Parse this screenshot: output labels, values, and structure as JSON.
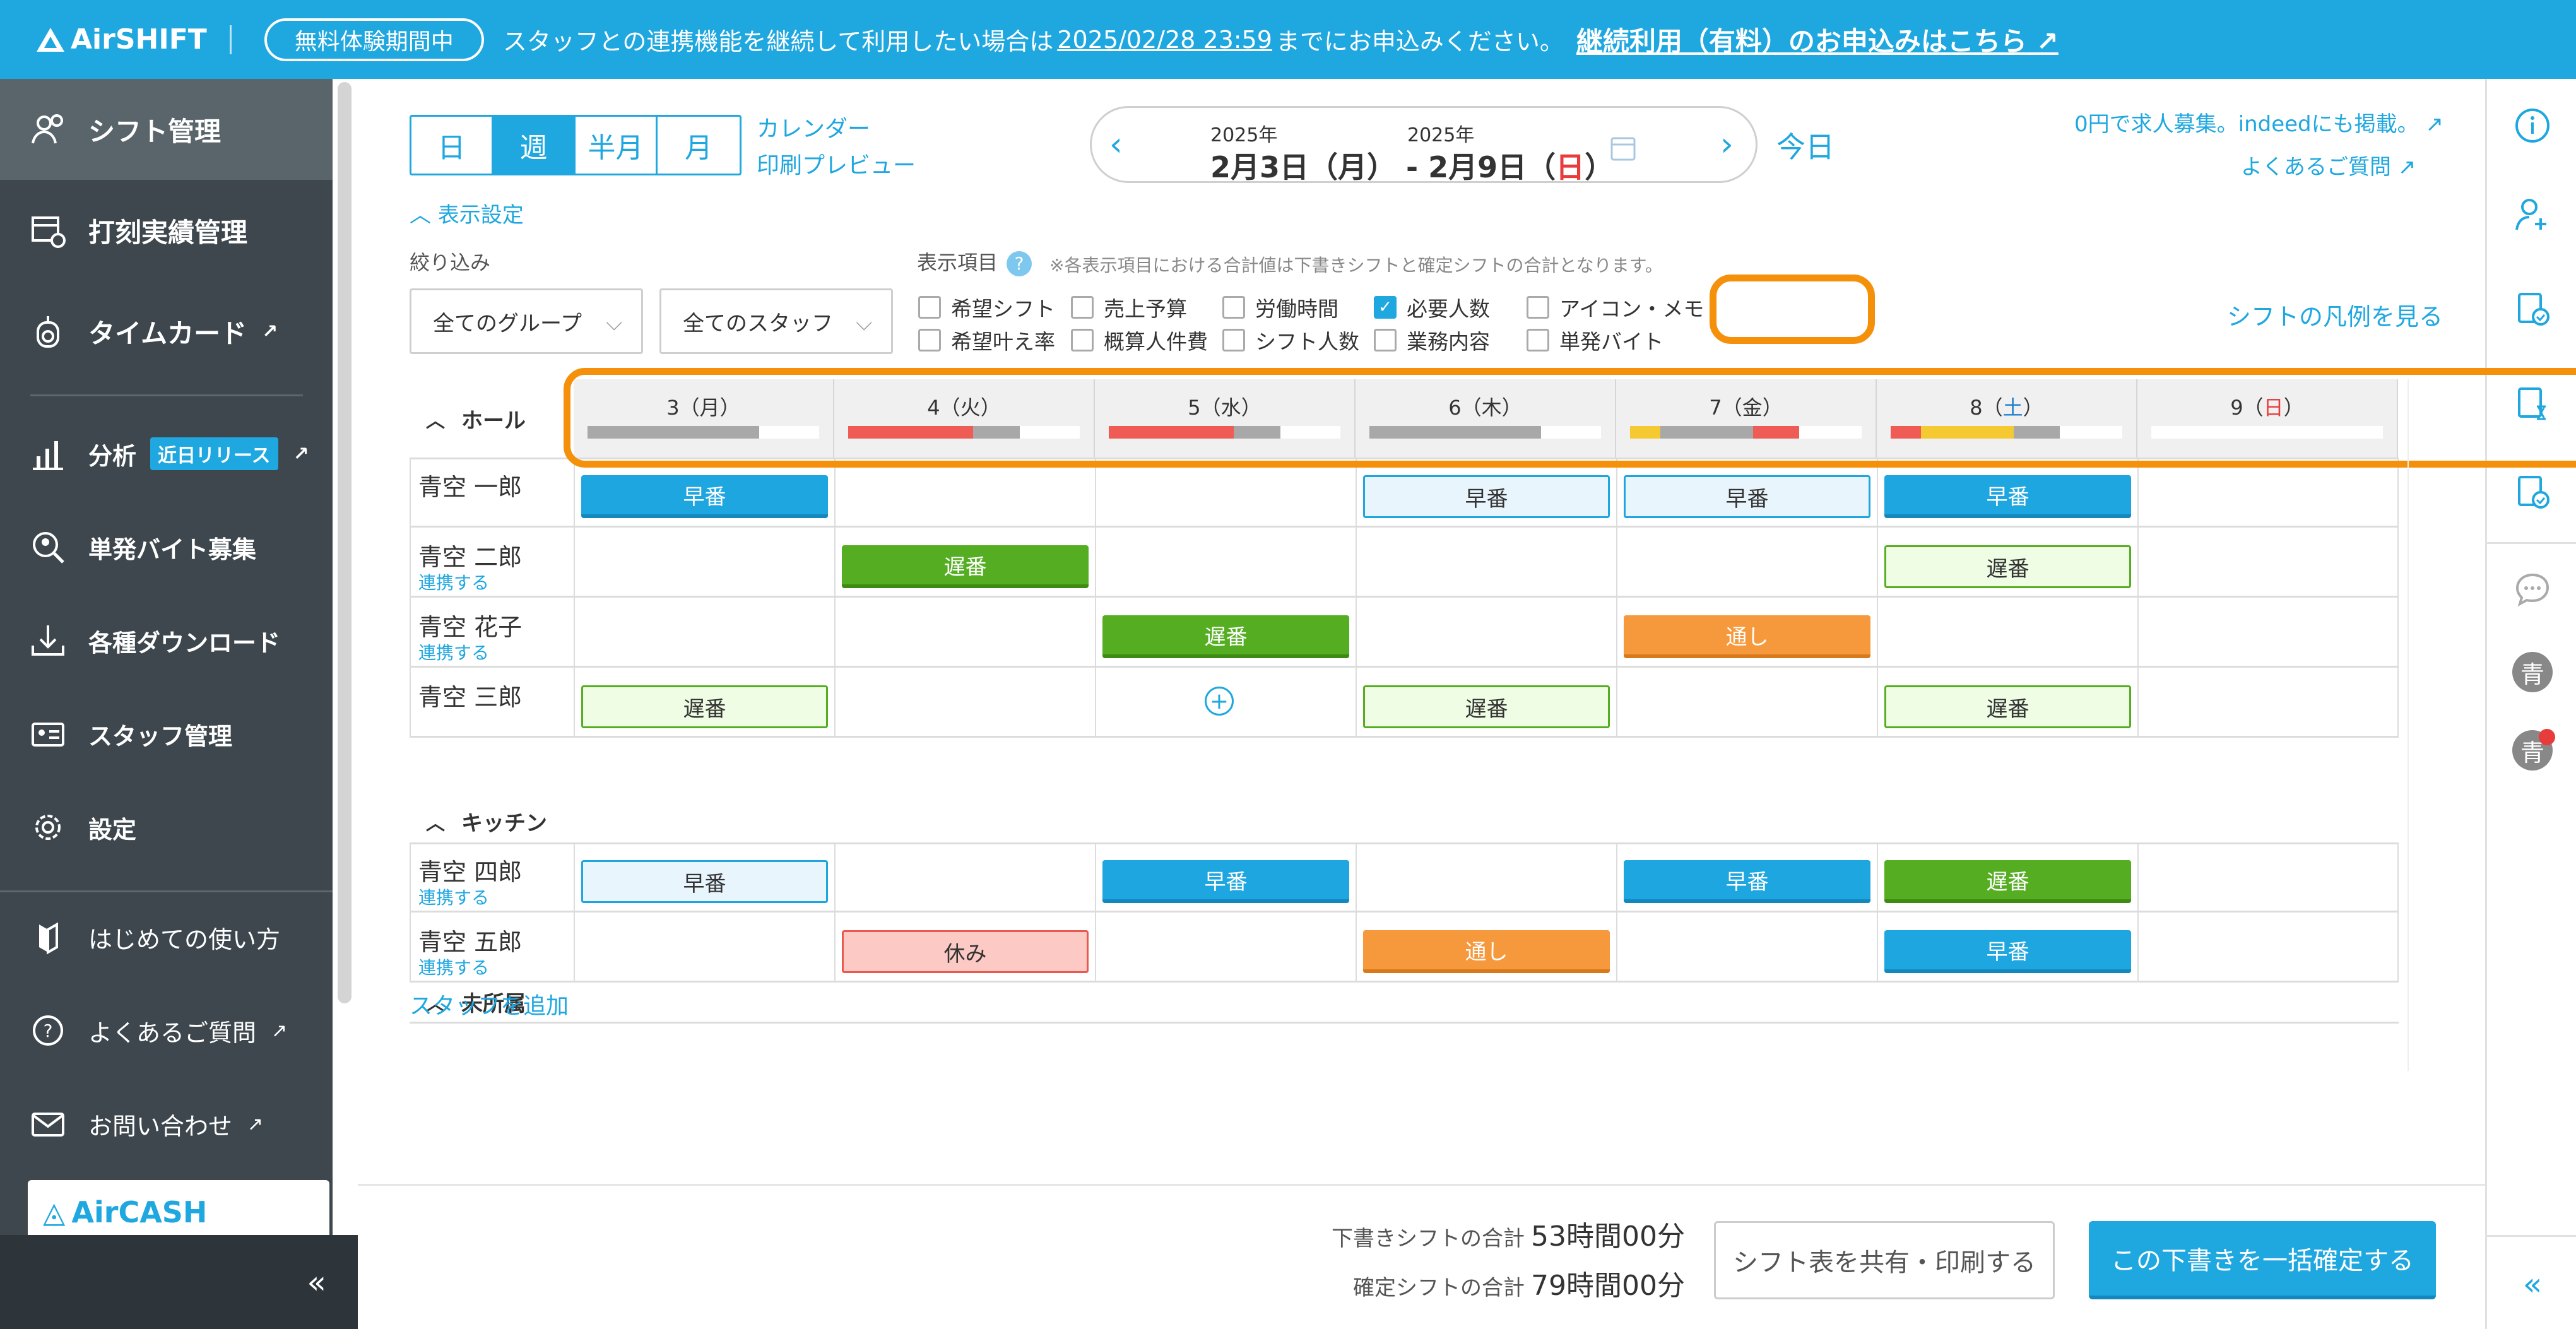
{
  "topbar": {
    "logo": "AirSHIFT",
    "trial_label": "無料体験期間中",
    "message_prefix": "スタッフとの連携機能を継続して利用したい場合は",
    "deadline": "2025/02/28 23:59",
    "message_suffix": "までにお申込みください。",
    "apply_link": "継続利用（有料）のお申込みはこちら"
  },
  "sidebar": {
    "items": [
      {
        "label": "シフト管理",
        "icon": "shift-people-icon",
        "active": true
      },
      {
        "label": "打刻実績管理",
        "icon": "clock-table-icon"
      },
      {
        "label": "タイムカード",
        "icon": "timecard-icon",
        "external": true
      },
      {
        "label": "分析",
        "icon": "chart-icon",
        "badge": "近日リリース",
        "external": true
      },
      {
        "label": "単発バイト募集",
        "icon": "person-search-icon"
      },
      {
        "label": "各種ダウンロード",
        "icon": "download-icon"
      },
      {
        "label": "スタッフ管理",
        "icon": "staff-card-icon"
      },
      {
        "label": "設定",
        "icon": "gear-icon"
      },
      {
        "label": "はじめての使い方",
        "icon": "book-icon"
      },
      {
        "label": "よくあるご質問",
        "icon": "question-icon",
        "external": true
      },
      {
        "label": "お問い合わせ",
        "icon": "mail-icon",
        "external": true
      }
    ],
    "aircash_label": "AirCASH",
    "collapse_label": "«"
  },
  "toolbar": {
    "views": [
      "日",
      "週",
      "半月",
      "月"
    ],
    "active_view": "週",
    "calendar_link": "カレンダー",
    "print_link": "印刷プレビュー",
    "start_year": "2025年",
    "end_year": "2025年",
    "start_date": "2月3日（月）",
    "range_sep": "-",
    "end_date_pre": "2月9日（",
    "end_date_day": "日",
    "end_date_post": "）",
    "today": "今日",
    "job_link": "0円で求人募集。indeedにも掲載。",
    "faq_link": "よくあるご質問"
  },
  "filters": {
    "display_settings": "表示設定",
    "filter_label": "絞り込み",
    "group_select": "全てのグループ",
    "staff_select": "全てのスタッフ",
    "display_items_label": "表示項目",
    "note": "※各表示項目における合計値は下書きシフトと確定シフトの合計となります。",
    "legend_link": "シフトの凡例を見る",
    "checkboxes": [
      {
        "label": "希望シフト",
        "checked": false
      },
      {
        "label": "売上予算",
        "checked": false
      },
      {
        "label": "労働時間",
        "checked": false
      },
      {
        "label": "必要人数",
        "checked": true
      },
      {
        "label": "アイコン・メモ",
        "checked": false
      },
      {
        "label": "希望叶え率",
        "checked": false
      },
      {
        "label": "概算人件費",
        "checked": false
      },
      {
        "label": "シフト人数",
        "checked": false
      },
      {
        "label": "業務内容",
        "checked": false
      },
      {
        "label": "単発バイト",
        "checked": false
      }
    ]
  },
  "schedule": {
    "groups": {
      "hall": "ホール",
      "kitchen": "キッチン",
      "unassigned": "未所属"
    },
    "days": [
      {
        "num": "3",
        "pre": "（",
        "dow": "月",
        "post": "）",
        "dow_color": "#333333"
      },
      {
        "num": "4",
        "pre": "（",
        "dow": "火",
        "post": "）",
        "dow_color": "#333333"
      },
      {
        "num": "5",
        "pre": "（",
        "dow": "水",
        "post": "）",
        "dow_color": "#333333"
      },
      {
        "num": "6",
        "pre": "（",
        "dow": "木",
        "post": "）",
        "dow_color": "#333333"
      },
      {
        "num": "7",
        "pre": "（",
        "dow": "金",
        "post": "）",
        "dow_color": "#333333"
      },
      {
        "num": "8",
        "pre": "（",
        "dow": "土",
        "post": "）",
        "dow_color": "#1f7fd0"
      },
      {
        "num": "9",
        "pre": "（",
        "dow": "日",
        "post": "）",
        "dow_color": "#e83b3b"
      }
    ],
    "staff_bars": [
      [
        {
          "color": "#a8a8a8",
          "frac": 0.74
        }
      ],
      [
        {
          "color": "#ef5c55",
          "frac": 0.54
        },
        {
          "color": "#a8a8a8",
          "frac": 0.2
        }
      ],
      [
        {
          "color": "#ef5c55",
          "frac": 0.54
        },
        {
          "color": "#a8a8a8",
          "frac": 0.2
        }
      ],
      [
        {
          "color": "#a8a8a8",
          "frac": 0.74
        }
      ],
      [
        {
          "color": "#f5c932",
          "frac": 0.13
        },
        {
          "color": "#a8a8a8",
          "frac": 0.4
        },
        {
          "color": "#ef5c55",
          "frac": 0.2
        }
      ],
      [
        {
          "color": "#ef5c55",
          "frac": 0.13
        },
        {
          "color": "#f5c932",
          "frac": 0.4
        },
        {
          "color": "#a8a8a8",
          "frac": 0.2
        }
      ],
      []
    ],
    "link_label": "連携する",
    "hall_rows": [
      {
        "name": "青空 一郎",
        "linked": false,
        "shifts": [
          {
            "label": "早番",
            "type": "s-early"
          },
          null,
          null,
          {
            "label": "早番",
            "type": "s-early-d"
          },
          {
            "label": "早番",
            "type": "s-early-d"
          },
          {
            "label": "早番",
            "type": "s-early"
          },
          null
        ]
      },
      {
        "name": "青空 二郎",
        "linked": true,
        "shifts": [
          null,
          {
            "label": "遅番",
            "type": "s-late"
          },
          null,
          null,
          null,
          {
            "label": "遅番",
            "type": "s-late-d"
          },
          null
        ]
      },
      {
        "name": "青空 花子",
        "linked": true,
        "shifts": [
          null,
          null,
          {
            "label": "遅番",
            "type": "s-late"
          },
          null,
          {
            "label": "通し",
            "type": "s-thru"
          },
          null,
          null
        ]
      },
      {
        "name": "青空 三郎",
        "linked": false,
        "shifts": [
          {
            "label": "遅番",
            "type": "s-late-d"
          },
          null,
          "plus",
          {
            "label": "遅番",
            "type": "s-late-d"
          },
          null,
          {
            "label": "遅番",
            "type": "s-late-d"
          },
          null
        ]
      }
    ],
    "kitchen_rows": [
      {
        "name": "青空 四郎",
        "linked": true,
        "shifts": [
          {
            "label": "早番",
            "type": "s-early-d"
          },
          null,
          {
            "label": "早番",
            "type": "s-early"
          },
          null,
          {
            "label": "早番",
            "type": "s-early"
          },
          {
            "label": "遅番",
            "type": "s-late"
          },
          null
        ]
      },
      {
        "name": "青空 五郎",
        "linked": true,
        "shifts": [
          null,
          {
            "label": "休み",
            "type": "s-off"
          },
          null,
          {
            "label": "通し",
            "type": "s-thru"
          },
          null,
          {
            "label": "早番",
            "type": "s-early"
          },
          null
        ]
      }
    ],
    "add_staff": "スタッフを追加"
  },
  "footer": {
    "draft_label": "下書きシフトの合計",
    "draft_value": "53時間00分",
    "confirmed_label": "確定シフトの合計",
    "confirmed_value": "79時間00分",
    "share_button": "シフト表を共有・印刷する",
    "confirm_button": "この下書きを一括確定する"
  },
  "rightbar": {
    "avatar_initial": "青"
  }
}
